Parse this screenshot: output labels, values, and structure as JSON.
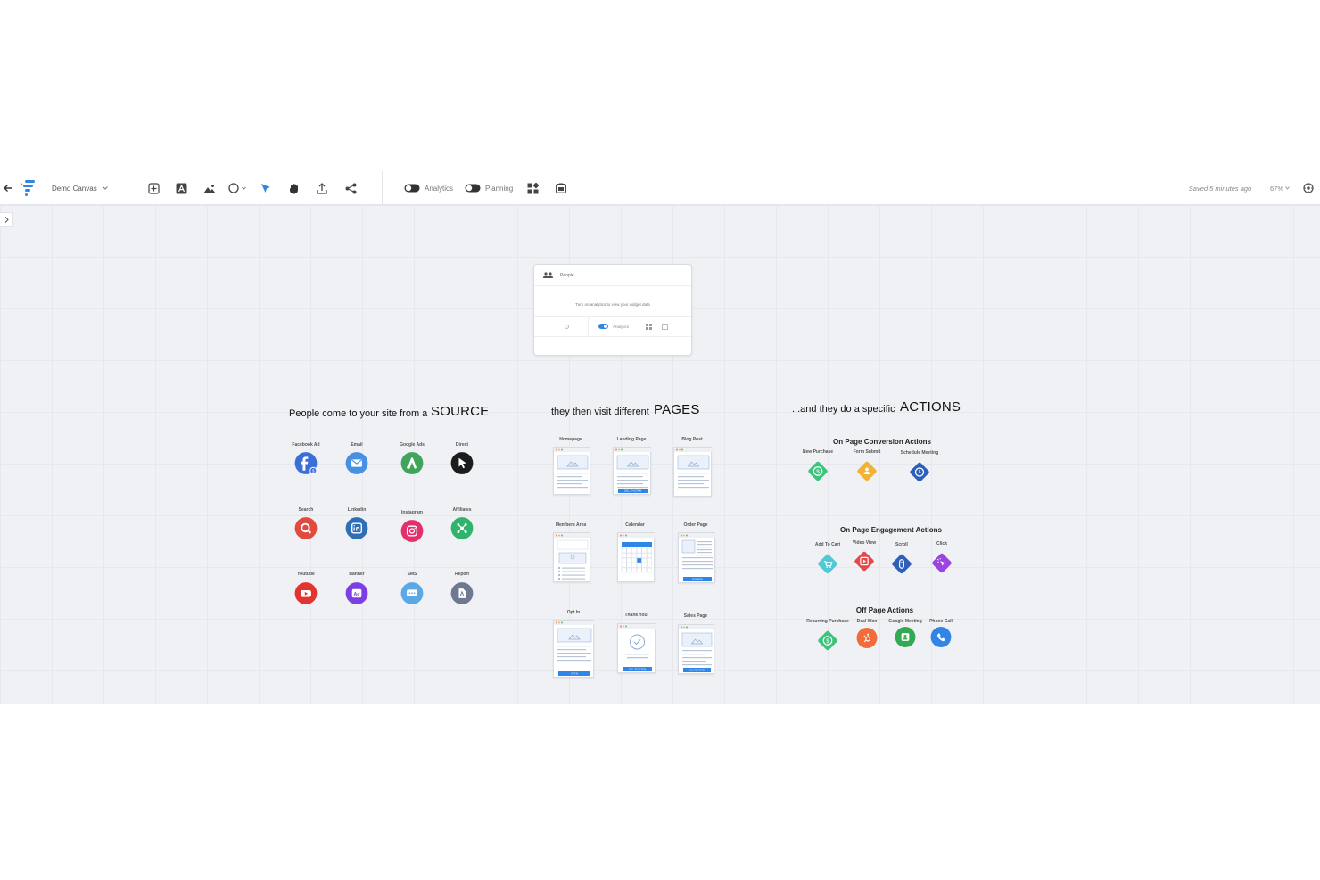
{
  "toolbar": {
    "canvas_name": "Demo Canvas",
    "analytics_label": "Analytics",
    "planning_label": "Planning",
    "saved_status": "Saved 5 minutes ago",
    "zoom": "67%"
  },
  "widget": {
    "title": "People",
    "message": "Turn on analytics to view your widget data",
    "analytics_label": "Analytics"
  },
  "sources": {
    "lead": "People come to your site from a",
    "headline": "SOURCE",
    "items": [
      {
        "label": "Facebook Ad",
        "icon": "facebook-ad-icon",
        "color": "#3b6fd8"
      },
      {
        "label": "Email",
        "icon": "email-icon",
        "color": "#4a90e2"
      },
      {
        "label": "Google Ads",
        "icon": "google-ads-icon",
        "color": "#3ea55a"
      },
      {
        "label": "Direct",
        "icon": "cursor-icon",
        "color": "#1c1c1c"
      },
      {
        "label": "Search",
        "icon": "search-icon",
        "color": "#e04a3f"
      },
      {
        "label": "Linkedin",
        "icon": "linkedin-icon",
        "color": "#2f6fb6"
      },
      {
        "label": "Instagram",
        "icon": "instagram-icon",
        "color": "#e1306c"
      },
      {
        "label": "Affiliates",
        "icon": "affiliates-icon",
        "color": "#2fb36d"
      },
      {
        "label": "Youtube",
        "icon": "youtube-icon",
        "color": "#e3342f"
      },
      {
        "label": "Banner",
        "icon": "banner-ad-icon",
        "color": "#7b3fe4"
      },
      {
        "label": "SMS",
        "icon": "sms-icon",
        "color": "#5aa9e6"
      },
      {
        "label": "Report",
        "icon": "report-icon",
        "color": "#6e7891"
      }
    ]
  },
  "pages": {
    "lead": "they then visit different",
    "headline": "PAGES",
    "items": [
      {
        "label": "Homepage"
      },
      {
        "label": "Landing Page",
        "cta": "CALL TO ACTION"
      },
      {
        "label": "Blog Post"
      },
      {
        "label": "Members Area"
      },
      {
        "label": "Calendar"
      },
      {
        "label": "Order Page",
        "cta": "BUY NOW"
      },
      {
        "label": "Opt In",
        "cta": "OPT IN"
      },
      {
        "label": "Thank You",
        "cta": "CALL TO ACTION"
      },
      {
        "label": "Sales Page",
        "cta": "CALL TO ACTION"
      }
    ]
  },
  "actions": {
    "lead": "...and they do a specific",
    "headline": "ACTIONS",
    "groups": [
      {
        "title": "On Page Conversion Actions",
        "items": [
          {
            "label": "New Purchase",
            "icon": "dollar-icon",
            "color": "#3cc47c"
          },
          {
            "label": "Form Submit",
            "icon": "person-icon",
            "color": "#f3b234"
          },
          {
            "label": "Schedule Meeting",
            "icon": "clock-icon",
            "color": "#2c5fb8"
          }
        ]
      },
      {
        "title": "On Page Engagement Actions",
        "items": [
          {
            "label": "Add To Cart",
            "icon": "cart-icon",
            "color": "#4fc9d4"
          },
          {
            "label": "Video View",
            "icon": "video-icon",
            "color": "#e5474a"
          },
          {
            "label": "Scroll",
            "icon": "scroll-icon",
            "color": "#2f5fb8"
          },
          {
            "label": "Click",
            "icon": "click-icon",
            "color": "#9b44e0"
          }
        ]
      },
      {
        "title": "Off Page Actions",
        "items": [
          {
            "label": "Recurring Purchase",
            "icon": "dollar-icon",
            "color": "#3cc47c"
          },
          {
            "label": "Deal Won",
            "icon": "hubspot-icon",
            "color": "#f26b3a"
          },
          {
            "label": "Google Meeting",
            "icon": "meeting-icon",
            "color": "#34a853"
          },
          {
            "label": "Phone Call",
            "icon": "phone-icon",
            "color": "#2f86e6"
          }
        ]
      }
    ]
  }
}
